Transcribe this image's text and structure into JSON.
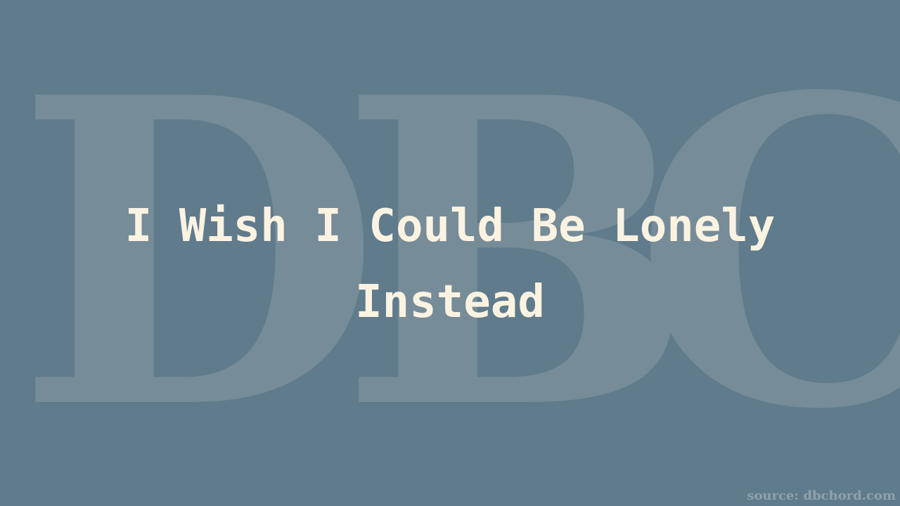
{
  "watermark": {
    "letters": [
      "D",
      "B",
      "C"
    ]
  },
  "title": "I Wish I Could Be Lonely Instead",
  "source": "source: dbchord.com",
  "colors": {
    "background": "#5f7b8c",
    "watermark": "#768c98",
    "title": "#fbf3e2",
    "source": "#8fa2ad"
  }
}
